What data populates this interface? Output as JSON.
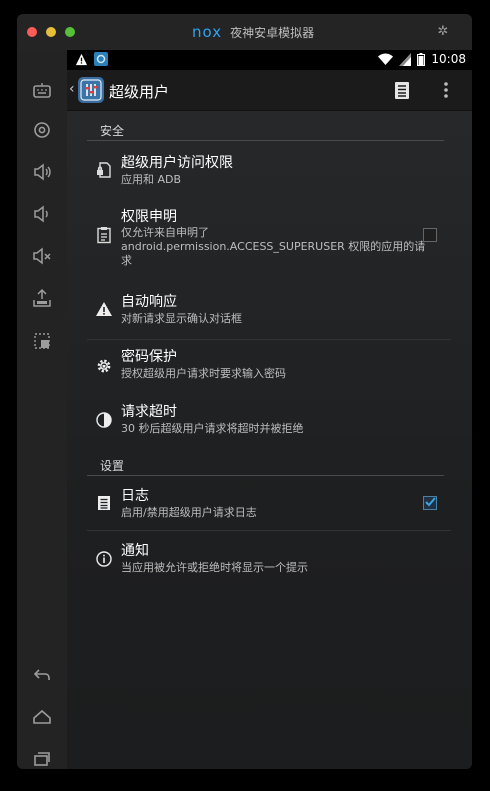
{
  "window": {
    "brand_logo": "nox",
    "brand_name": "夜神安卓模拟器"
  },
  "statusbar": {
    "time": "10:08"
  },
  "actionbar": {
    "title": "超级用户"
  },
  "sections": {
    "security": "安全",
    "settings": "设置"
  },
  "items": {
    "access": {
      "title": "超级用户访问权限",
      "subtitle": "应用和 ADB"
    },
    "declare": {
      "title": "权限申明",
      "subtitle": "仅允许来自申明了\nandroid.permission.ACCESS_SUPERUSER 权限的应用的请求",
      "checked": false
    },
    "auto": {
      "title": "自动响应",
      "subtitle": "对新请求显示确认对话框"
    },
    "pin": {
      "title": "密码保护",
      "subtitle": "授权超级用户请求时要求输入密码"
    },
    "timeout": {
      "title": "请求超时",
      "subtitle": "30 秒后超级用户请求将超时并被拒绝"
    },
    "log": {
      "title": "日志",
      "subtitle": "启用/禁用超级用户请求日志",
      "checked": true
    },
    "notify": {
      "title": "通知",
      "subtitle": "当应用被允许或拒绝时将显示一个提示"
    }
  },
  "colors": {
    "accent": "#2ea3f2",
    "check": "#3aa3e3"
  }
}
